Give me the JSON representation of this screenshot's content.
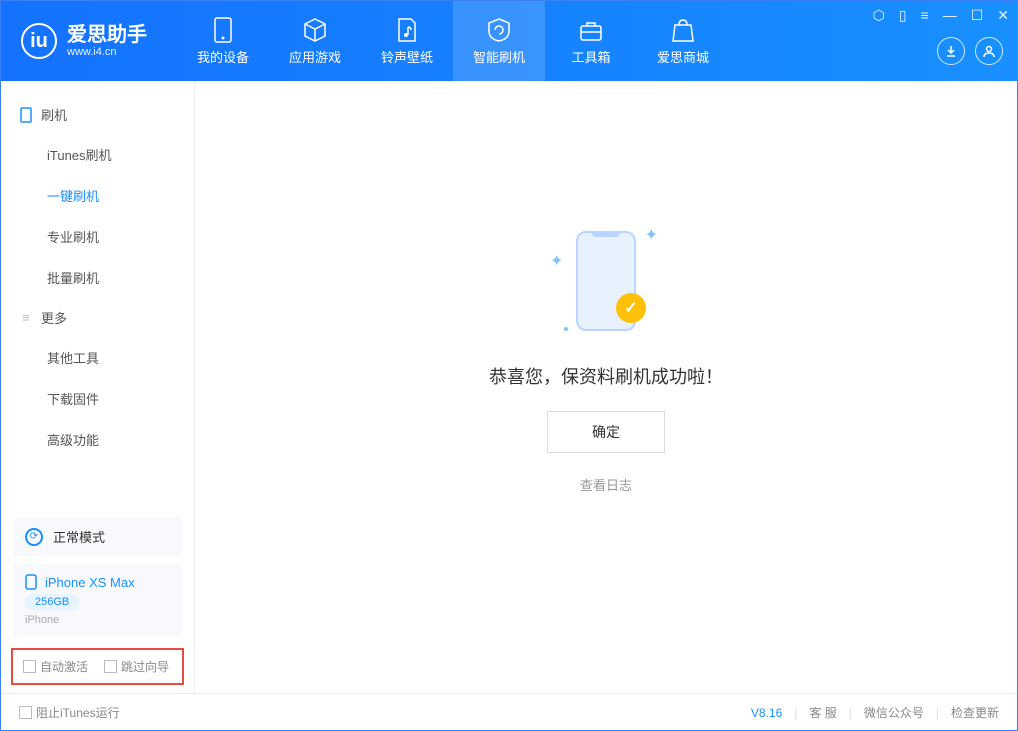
{
  "app": {
    "name": "爱思助手",
    "url": "www.i4.cn"
  },
  "tabs": [
    {
      "label": "我的设备"
    },
    {
      "label": "应用游戏"
    },
    {
      "label": "铃声壁纸"
    },
    {
      "label": "智能刷机"
    },
    {
      "label": "工具箱"
    },
    {
      "label": "爱思商城"
    }
  ],
  "sidebar": {
    "section1": {
      "title": "刷机"
    },
    "items1": [
      {
        "label": "iTunes刷机"
      },
      {
        "label": "一键刷机"
      },
      {
        "label": "专业刷机"
      },
      {
        "label": "批量刷机"
      }
    ],
    "section2": {
      "title": "更多"
    },
    "items2": [
      {
        "label": "其他工具"
      },
      {
        "label": "下载固件"
      },
      {
        "label": "高级功能"
      }
    ]
  },
  "mode": {
    "label": "正常模式"
  },
  "device": {
    "name": "iPhone XS Max",
    "storage": "256GB",
    "type": "iPhone"
  },
  "options": {
    "auto_activate": "自动激活",
    "skip_guide": "跳过向导"
  },
  "main": {
    "success_text": "恭喜您，保资料刷机成功啦！",
    "ok_button": "确定",
    "view_log": "查看日志"
  },
  "footer": {
    "block_itunes": "阻止iTunes运行",
    "version": "V8.16",
    "support": "客 服",
    "wechat": "微信公众号",
    "update": "检查更新"
  }
}
